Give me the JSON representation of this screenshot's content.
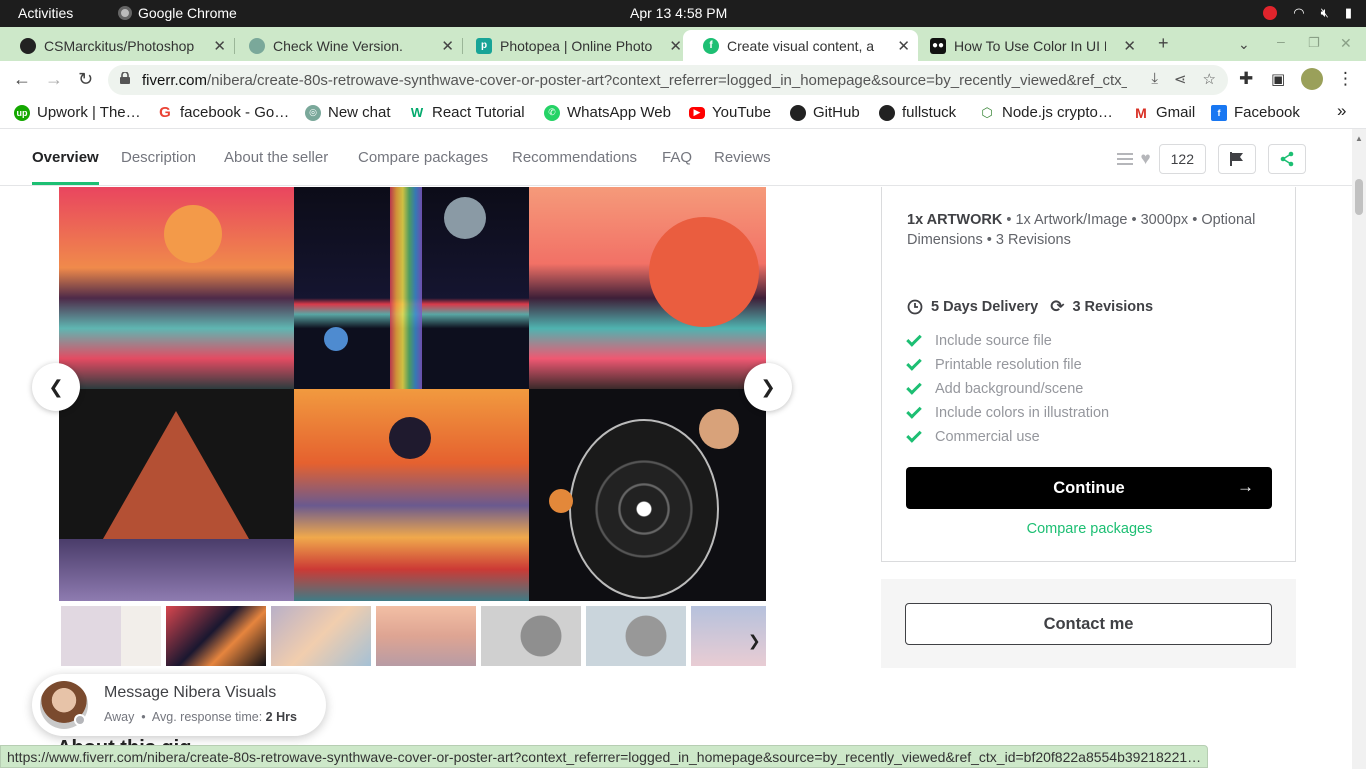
{
  "system": {
    "activities": "Activities",
    "app_name": "Google Chrome",
    "clock": "Apr 13  4:58 PM"
  },
  "tabs": [
    {
      "title": "CSMarckitus/Photoshop",
      "icon": "github-icon"
    },
    {
      "title": "Check Wine Version.",
      "icon": "chatgpt-icon"
    },
    {
      "title": "Photopea | Online Photo",
      "icon": "photopea-icon"
    },
    {
      "title": "Create visual content, a",
      "icon": "fiverr-icon",
      "active": true
    },
    {
      "title": "How To Use Color In UI D",
      "icon": "medium-icon"
    }
  ],
  "address": {
    "domain": "fiverr.com",
    "path": "/nibera/create-80s-retrowave-synthwave-cover-or-poster-art?context_referrer=logged_in_homepage&source=by_recently_viewed&ref_ctx_id=..."
  },
  "bookmarks": [
    {
      "label": "Upwork | The…",
      "icon": "upwork-icon",
      "color": "#14a800"
    },
    {
      "label": "facebook - Go…",
      "icon": "google-icon",
      "color": "#ea4335"
    },
    {
      "label": "New chat",
      "icon": "chatgpt-icon",
      "color": "#7aa89a"
    },
    {
      "label": "React Tutorial",
      "icon": "w3schools-icon",
      "color": "#04aa6d"
    },
    {
      "label": "WhatsApp Web",
      "icon": "whatsapp-icon",
      "color": "#25d366"
    },
    {
      "label": "YouTube",
      "icon": "youtube-icon",
      "color": "#ff0000"
    },
    {
      "label": "GitHub",
      "icon": "github-icon",
      "color": "#222222"
    },
    {
      "label": "fullstuck",
      "icon": "github-icon",
      "color": "#222222"
    },
    {
      "label": "Node.js crypto…",
      "icon": "nodejs-icon",
      "color": "#3c873a"
    },
    {
      "label": "Gmail",
      "icon": "gmail-icon",
      "color": "#d93025"
    },
    {
      "label": "Facebook",
      "icon": "facebook-icon",
      "color": "#1877f2"
    }
  ],
  "subnav": {
    "tabs": [
      "Overview",
      "Description",
      "About the seller",
      "Compare packages",
      "Recommendations",
      "FAQ",
      "Reviews"
    ],
    "active": "Overview",
    "likes": "122"
  },
  "package": {
    "title": "1x ARTWORK",
    "details": " • 1x Artwork/Image • 3000px • Optional Dimensions • 3 Revisions",
    "delivery": "5 Days Delivery",
    "revisions": "3 Revisions",
    "features": [
      "Include source file",
      "Printable resolution file",
      "Add background/scene",
      "Include colors in illustration",
      "Commercial use"
    ],
    "continue_label": "Continue",
    "compare_label": "Compare packages",
    "contact_label": "Contact me"
  },
  "message": {
    "title": "Message Nibera Visuals",
    "status": "Away",
    "response_label": "Avg. response time:",
    "response_value": "2 Hrs"
  },
  "about_heading_peek": "About this gig",
  "status_url": "https://www.fiverr.com/nibera/create-80s-retrowave-synthwave-cover-or-poster-art?context_referrer=logged_in_homepage&source=by_recently_viewed&ref_ctx_id=bf20f822a8554b39218221…",
  "colors": {
    "accent": "#1dbf73",
    "tabstrip": "#cde8c9",
    "button_dark": "#000000"
  }
}
